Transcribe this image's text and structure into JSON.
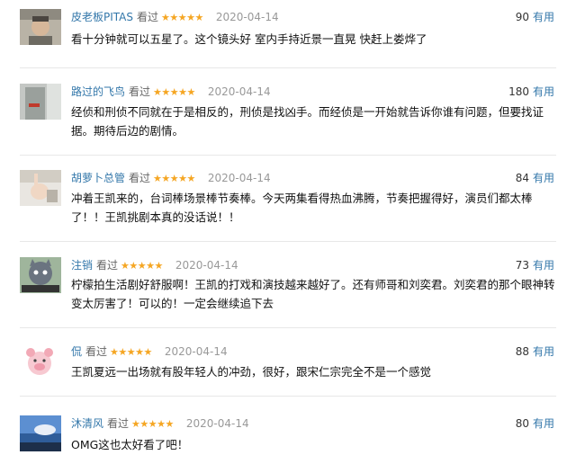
{
  "reviews": [
    {
      "user": "皮老板PITAS",
      "status": "看过",
      "stars": "★★★★★",
      "date": "2020-04-14",
      "votes": "90",
      "useful": "有用",
      "text": "看十分钟就可以五星了。这个镜头好 室内手持近景一直晃 快赶上娄烨了",
      "avatar_icon": "portrait-avatar-icon"
    },
    {
      "user": "路过的飞鸟",
      "status": "看过",
      "stars": "★★★★★",
      "date": "2020-04-14",
      "votes": "180",
      "useful": "有用",
      "text": "经侦和刑侦不同就在于是相反的，刑侦是找凶手。而经侦是一开始就告诉你谁有问题，但要找证据。期待后边的剧情。",
      "avatar_icon": "door-avatar-icon"
    },
    {
      "user": "胡萝卜总管",
      "status": "看过",
      "stars": "★★★★★",
      "date": "2020-04-14",
      "votes": "84",
      "useful": "有用",
      "text": "冲着王凯来的，台词棒场景棒节奏棒。今天两集看得热血沸腾，节奏把握得好，演员们都太棒了！！王凯挑剧本真的没话说！！",
      "avatar_icon": "hand-avatar-icon"
    },
    {
      "user": "注销",
      "status": "看过",
      "stars": "★★★★★",
      "date": "2020-04-14",
      "votes": "73",
      "useful": "有用",
      "text": "柠檬拍生活剧好舒服啊！王凯的打戏和演技越来越好了。还有师哥和刘奕君。刘奕君的那个眼神转变太厉害了！可以的！一定会继续追下去",
      "avatar_icon": "cat-avatar-icon"
    },
    {
      "user": "侃",
      "status": "看过",
      "stars": "★★★★★",
      "date": "2020-04-14",
      "votes": "88",
      "useful": "有用",
      "text": "王凯夏远一出场就有股年轻人的冲劲，很好，跟宋仁宗完全不是一个感觉",
      "avatar_icon": "pink-pig-avatar-icon"
    },
    {
      "user": "沐清风",
      "status": "看过",
      "stars": "★★★★★",
      "date": "2020-04-14",
      "votes": "80",
      "useful": "有用",
      "text": "OMG这也太好看了吧！",
      "avatar_icon": "sky-avatar-icon"
    }
  ],
  "colors": {
    "link": "#3377aa",
    "star": "#f5a623",
    "date": "#999999",
    "divider": "#e8e8e8"
  }
}
